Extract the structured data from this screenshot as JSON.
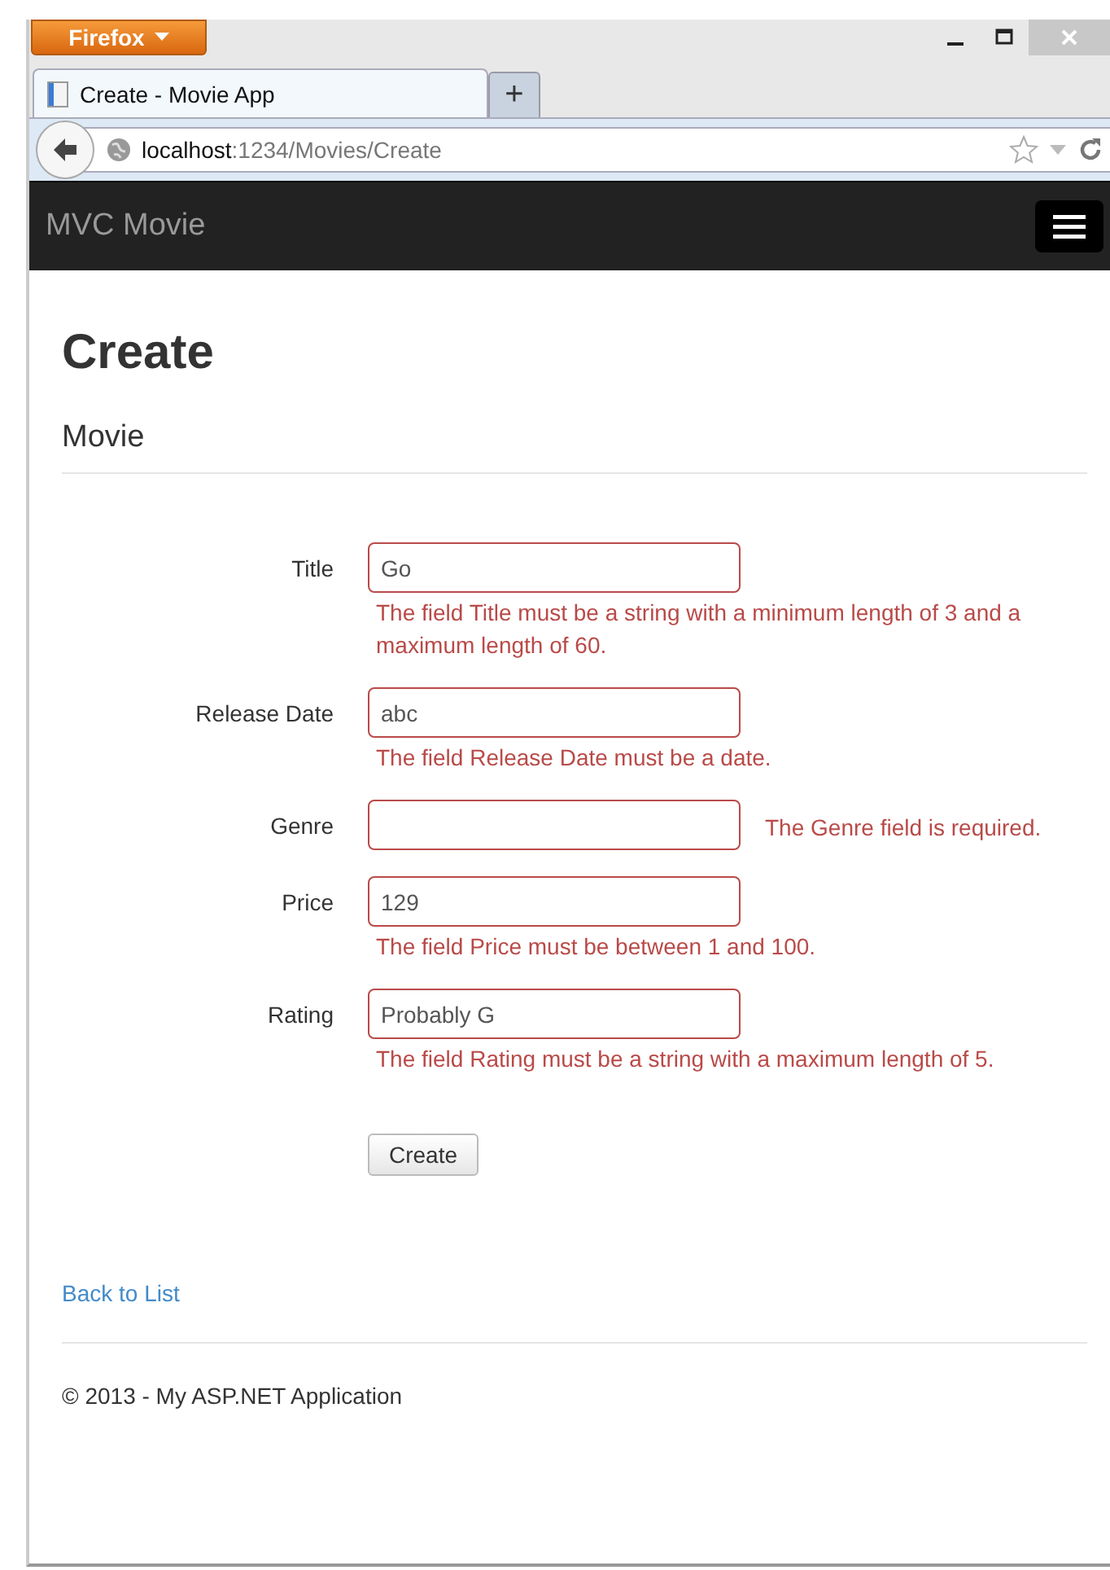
{
  "browser": {
    "menu_button": "Firefox",
    "tabs": [
      {
        "title": "Create - Movie App",
        "selected": true
      }
    ],
    "new_tab": "+",
    "url_host": "localhost",
    "url_path": ":1234/Movies/Create"
  },
  "navbar": {
    "brand": "MVC Movie"
  },
  "page": {
    "heading": "Create",
    "subheading": "Movie",
    "fields": [
      {
        "label": "Title",
        "value": "Go",
        "invalid": true,
        "error": "The field Title must be a string with a minimum length of 3 and a maximum length of 60."
      },
      {
        "label": "Release Date",
        "value": "abc",
        "invalid": true,
        "error": "The field Release Date must be a date."
      },
      {
        "label": "Genre",
        "invalid": true,
        "error": "The Genre field is required."
      },
      {
        "label": "Price",
        "value": "129",
        "invalid": true,
        "error": "The field Price must be between 1 and 100."
      },
      {
        "label": "Rating",
        "value": "Probably G",
        "invalid": true,
        "error": "The field Rating must be a string with a maximum length of 5."
      }
    ],
    "submit": "Create",
    "back_link": "Back to List",
    "footer": "© 2013 - My ASP.NET Application"
  }
}
